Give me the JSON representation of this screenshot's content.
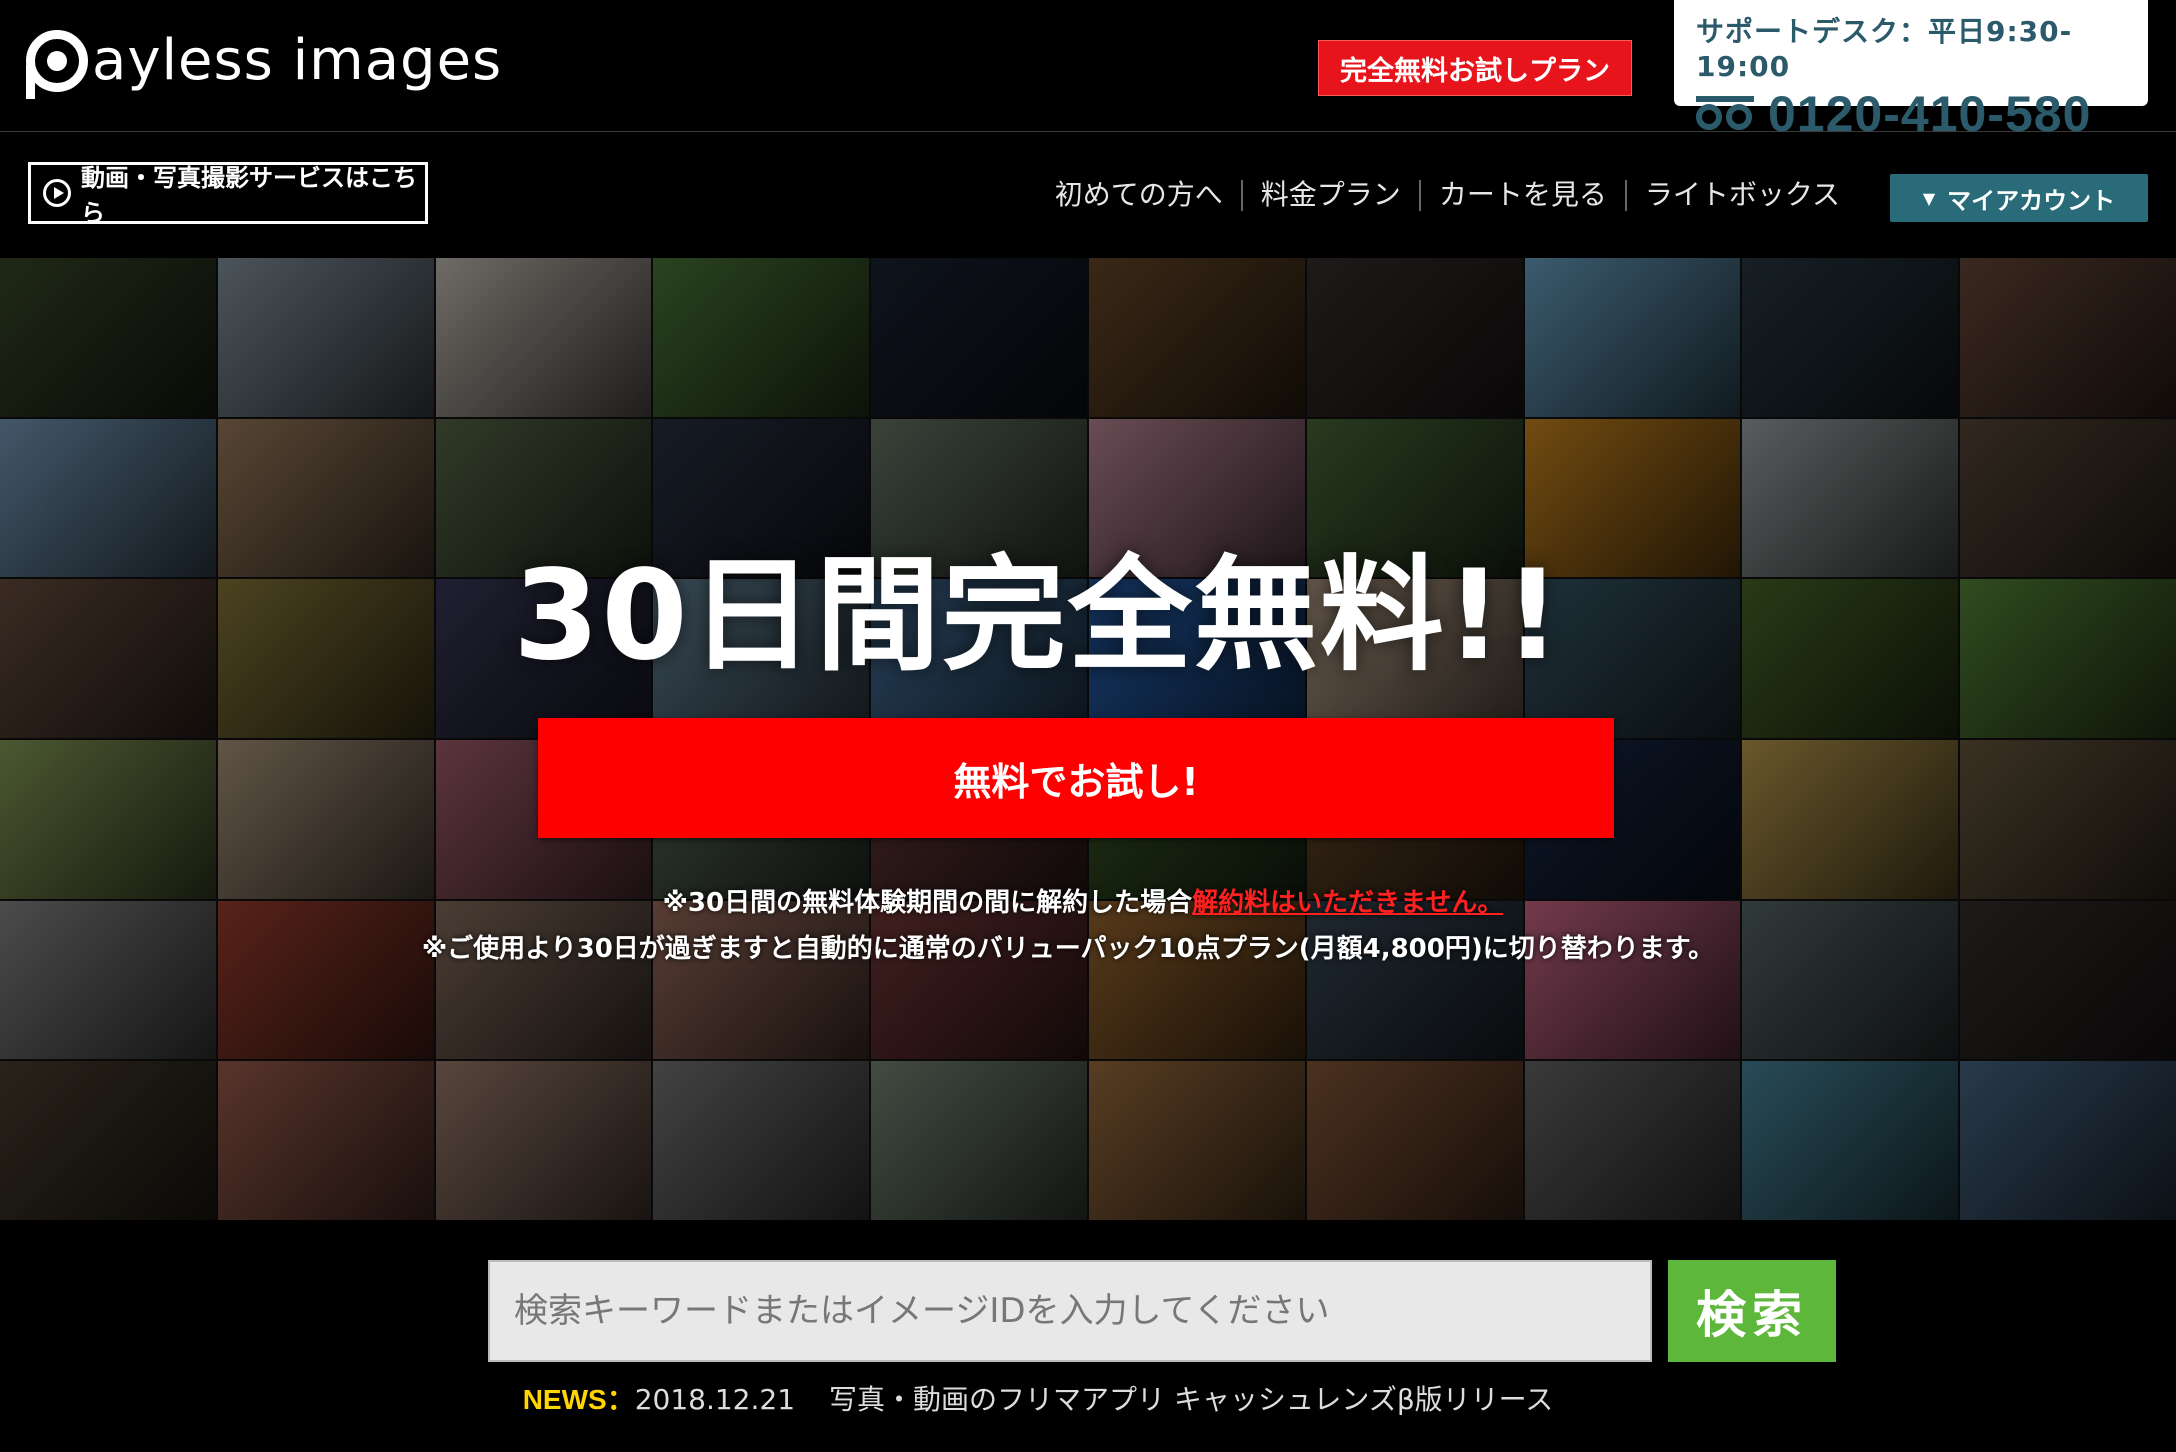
{
  "header": {
    "logo_text": "ayless images",
    "trial_badge": "完全無料お試しプラン",
    "support_label": "サポートデスク：平日9:30-19:00",
    "support_phone": "0120-410-580"
  },
  "nav": {
    "service_link": "動画・写真撮影サービスはこちら",
    "links": [
      "初めての方へ",
      "料金プラン",
      "カートを見る",
      "ライトボックス"
    ],
    "account_label": "マイアカウント",
    "account_caret": "▼"
  },
  "hero": {
    "title": "30日間完全無料!!",
    "cta": "無料でお試し!",
    "note1_prefix": "※30日間の無料体験期間の間に解約した場合",
    "note1_highlight": "解約料はいただきません。",
    "note2": "※ご使用より30日が過ぎますと自動的に通常のバリューパック10点プラン(月額4,800円)に切り替わります。"
  },
  "search": {
    "placeholder": "検索キーワードまたはイメージIDを入力してください",
    "button": "検索"
  },
  "news": {
    "label": "NEWS：",
    "date": "2018.12.21",
    "text": "写真・動画のフリマアプリ キャッシュレンズβ版リリース"
  },
  "colors": {
    "trial_red": "#e8141b",
    "cta_red": "#ff0000",
    "account_teal": "#2a6b79",
    "support_text": "#2b5a6b",
    "search_green": "#5db73a",
    "news_yellow": "#ffd600"
  },
  "mosaic_colors": [
    "#3a4a2a",
    "#8a9aa6",
    "#c9c2b8",
    "#4e7a3a",
    "#1b2333",
    "#6a4a2a",
    "#3a3030",
    "#6ca6c8",
    "#2a3a44",
    "#6a4a3a",
    "#7aa0c0",
    "#a08060",
    "#5a6a4a",
    "#2a3344",
    "#6a7a6a",
    "#c08a9a",
    "#4a6a3a",
    "#d08a20",
    "#a0a8a8",
    "#5a4a3a",
    "#6a5040",
    "#8a7a3a",
    "#3a3a5a",
    "#6a8aa0",
    "#4a7aa8",
    "#2a6ac0",
    "#c0a890",
    "#3a5a6a",
    "#4a6a2a",
    "#5a8a3a",
    "#8aa05a",
    "#b09a80",
    "#a86070",
    "#5a6a5a",
    "#6a3a3a",
    "#3a5a2a",
    "#6a4a2a",
    "#1a2a4a",
    "#c0a050",
    "#6a5a40",
    "#8a8a8a",
    "#a04030",
    "#8a7060",
    "#a07060",
    "#7a3a3a",
    "#a06a30",
    "#3a4a5a",
    "#d06a8a",
    "#5a6a6a",
    "#3a3030",
    "#4a4030",
    "#a06050",
    "#a08070",
    "#7a7a7a",
    "#7a8a7a",
    "#a07040",
    "#8a5a3a",
    "#6a6a6a",
    "#4a8aa0",
    "#4a6a8a"
  ]
}
